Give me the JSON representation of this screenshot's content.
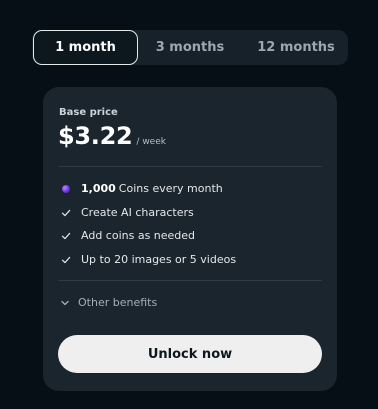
{
  "tabs": [
    {
      "label": "1 month",
      "active": true
    },
    {
      "label": "3 months",
      "active": false
    },
    {
      "label": "12 months",
      "active": false
    }
  ],
  "plan": {
    "base_label": "Base price",
    "price": "$3.22",
    "per": "/ week"
  },
  "features": [
    {
      "icon": "coin-icon",
      "bold": "1,000",
      "text": "Coins every month"
    },
    {
      "icon": "check-icon",
      "text": "Create AI characters"
    },
    {
      "icon": "check-icon",
      "text": "Add coins as needed"
    },
    {
      "icon": "check-icon",
      "text": "Up to 20 images or 5 videos"
    }
  ],
  "other_benefits": {
    "icon": "chevron-down-icon",
    "label": "Other benefits"
  },
  "cta": {
    "label": "Unlock now"
  },
  "colors": {
    "background": "#050f15",
    "card": "#1b252d",
    "button": "#efefef",
    "coin_accent": "#6b37e0"
  }
}
